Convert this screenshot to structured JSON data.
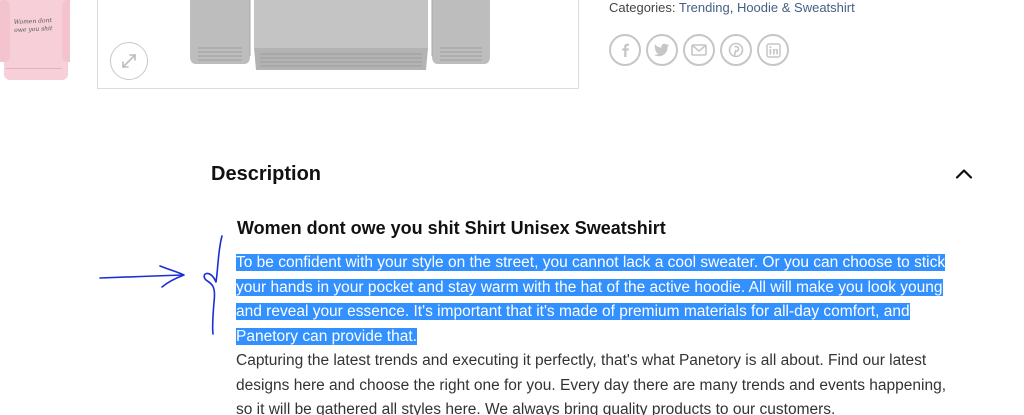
{
  "thumbnail": {
    "scrawl_text": "Women dont owe you shit"
  },
  "categories": {
    "label": "Categories:",
    "links": [
      "Trending",
      "Hoodie & Sweatshirt"
    ],
    "separator": ", "
  },
  "share": {
    "icons": [
      "facebook-icon",
      "twitter-icon",
      "email-icon",
      "pinterest-icon",
      "linkedin-icon"
    ]
  },
  "description": {
    "tab_title": "Description"
  },
  "product": {
    "heading": "Women dont owe you shit Shirt Unisex Sweatshirt",
    "paragraph_highlighted": "To be confident with your style on the street, you cannot lack a cool sweater. Or you can choose to stick your hands in your pocket and stay warm with the hat of the active hoodie. All will make you look young and reveal your essence. It's important that it's made of premium materials for all-day comfort, and Panetory can provide that.",
    "paragraph_2": "Capturing the latest trends and executing it perfectly, that's what Panetory is all about. Find our latest designs here and choose the right one for you. Every day there are many trends and events happening, so it will be gathered all styles here. We always bring quality products to our customers."
  },
  "colors": {
    "accent_link": "#446084",
    "selection": "#3390ff",
    "annotation": "#1a2fd6"
  }
}
